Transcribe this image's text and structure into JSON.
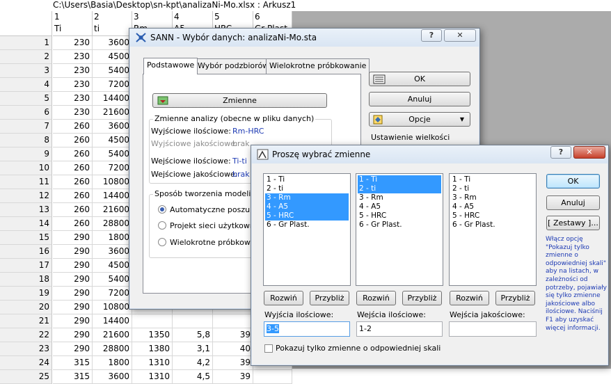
{
  "window_title": "C:\\Users\\Basia\\Desktop\\sn-kpt\\analizaNi-Mo.xlsx : Arkusz1",
  "sheet": {
    "columns": [
      {
        "num": "1",
        "name": "Ti"
      },
      {
        "num": "2",
        "name": "ti"
      },
      {
        "num": "3",
        "name": "Rm"
      },
      {
        "num": "4",
        "name": "A5"
      },
      {
        "num": "5",
        "name": "HRC"
      },
      {
        "num": "6",
        "name": "Gr Plast."
      }
    ],
    "rows": [
      {
        "n": "1",
        "c": [
          "230",
          "3600",
          "",
          "",
          "",
          ""
        ]
      },
      {
        "n": "2",
        "c": [
          "230",
          "4500",
          "",
          "",
          "",
          ""
        ]
      },
      {
        "n": "3",
        "c": [
          "230",
          "5400",
          "",
          "",
          "",
          ""
        ]
      },
      {
        "n": "4",
        "c": [
          "230",
          "7200",
          "",
          "",
          "",
          ""
        ]
      },
      {
        "n": "5",
        "c": [
          "230",
          "14400",
          "",
          "",
          "",
          ""
        ]
      },
      {
        "n": "6",
        "c": [
          "230",
          "21600",
          "",
          "",
          "",
          ""
        ]
      },
      {
        "n": "7",
        "c": [
          "260",
          "3600",
          "",
          "",
          "",
          ""
        ]
      },
      {
        "n": "8",
        "c": [
          "260",
          "4500",
          "",
          "",
          "",
          ""
        ]
      },
      {
        "n": "9",
        "c": [
          "260",
          "5400",
          "",
          "",
          "",
          ""
        ]
      },
      {
        "n": "10",
        "c": [
          "260",
          "7200",
          "",
          "",
          "",
          ""
        ]
      },
      {
        "n": "11",
        "c": [
          "260",
          "10800",
          "",
          "",
          "",
          ""
        ]
      },
      {
        "n": "12",
        "c": [
          "260",
          "14400",
          "",
          "",
          "",
          ""
        ]
      },
      {
        "n": "13",
        "c": [
          "260",
          "21600",
          "",
          "",
          "",
          ""
        ]
      },
      {
        "n": "14",
        "c": [
          "260",
          "28800",
          "",
          "",
          "",
          ""
        ]
      },
      {
        "n": "15",
        "c": [
          "290",
          "1800",
          "",
          "",
          "",
          ""
        ]
      },
      {
        "n": "16",
        "c": [
          "290",
          "3600",
          "",
          "",
          "",
          ""
        ]
      },
      {
        "n": "17",
        "c": [
          "290",
          "4500",
          "",
          "",
          "",
          ""
        ]
      },
      {
        "n": "18",
        "c": [
          "290",
          "5400",
          "",
          "",
          "",
          ""
        ]
      },
      {
        "n": "19",
        "c": [
          "290",
          "7200",
          "",
          "",
          "",
          ""
        ]
      },
      {
        "n": "20",
        "c": [
          "290",
          "10800",
          "",
          "",
          "",
          ""
        ]
      },
      {
        "n": "21",
        "c": [
          "290",
          "14400",
          "",
          "",
          "",
          ""
        ]
      },
      {
        "n": "22",
        "c": [
          "290",
          "21600",
          "1350",
          "5,8",
          "39",
          ""
        ]
      },
      {
        "n": "23",
        "c": [
          "290",
          "28800",
          "1380",
          "3,1",
          "40",
          ""
        ]
      },
      {
        "n": "24",
        "c": [
          "315",
          "1800",
          "1310",
          "4,2",
          "39",
          ""
        ]
      },
      {
        "n": "25",
        "c": [
          "315",
          "3600",
          "1310",
          "4,5",
          "39",
          ""
        ]
      }
    ]
  },
  "sann": {
    "title": "SANN - Wybór danych: analizaNi-Mo.sta",
    "help_btn": "?",
    "close_btn": "✕",
    "tabs": [
      "Podstawowe",
      "Wybór podzbiorów",
      "Wielokrotne próbkowanie"
    ],
    "variables_btn": "Zmienne",
    "variables_section": "Zmienne analizy (obecne w pliku danych)",
    "out_quant_label": "Wyjściowe ilościowe:",
    "out_quant_value": "Rm-HRC",
    "out_qual_label": "Wyjściowe jakościowe:",
    "out_qual_value": "brak",
    "in_quant_label": "Wejściowe ilościowe:",
    "in_quant_value": "Ti-ti",
    "in_qual_label": "Wejściowe jakościowe:",
    "in_qual_value": "brak",
    "model_section": "Sposób tworzenia modeli",
    "radio_auto": "Automatyczne poszukiwa",
    "radio_project": "Projekt sieci użytkownika",
    "radio_multi": "Wielokrotne próbkowanie",
    "ok_btn": "OK",
    "cancel_btn": "Anuluj",
    "options_btn": "Opcje",
    "settings_text": "Ustawienie wielkości"
  },
  "choose": {
    "title": "Proszę wybrać zmienne",
    "help_btn": "?",
    "close_btn": "✕",
    "list_items": [
      "1 - Ti",
      "2 - ti",
      "3 - Rm",
      "4 - A5",
      "5 - HRC",
      "6 - Gr Plast."
    ],
    "expand_btn": "Rozwiń",
    "zoom_btn": "Przybliż",
    "out_quant_label": "Wyjścia ilościowe:",
    "out_quant_value": "3-5",
    "in_quant_label": "Wejścia ilościowe:",
    "in_quant_value": "1-2",
    "in_qual_label": "Wejścia jakościowe:",
    "in_qual_value": "",
    "checkbox_label": "Pokazuj tylko zmienne o odpowiedniej skali",
    "ok_btn": "OK",
    "cancel_btn": "Anuluj",
    "sets_btn": "[ Zestawy ]...",
    "hint_lines": [
      "Włącz opcję",
      "\"Pokazuj tylko",
      "zmienne o",
      "odpowiedniej skali\"",
      "aby na listach, w",
      "zależności od",
      "potrzeby, pojawiały",
      "się tylko zmienne",
      "jakościowe albo",
      "ilościowe. Naciśnij",
      "F1 aby uzyskać",
      "więcej informacji."
    ]
  }
}
